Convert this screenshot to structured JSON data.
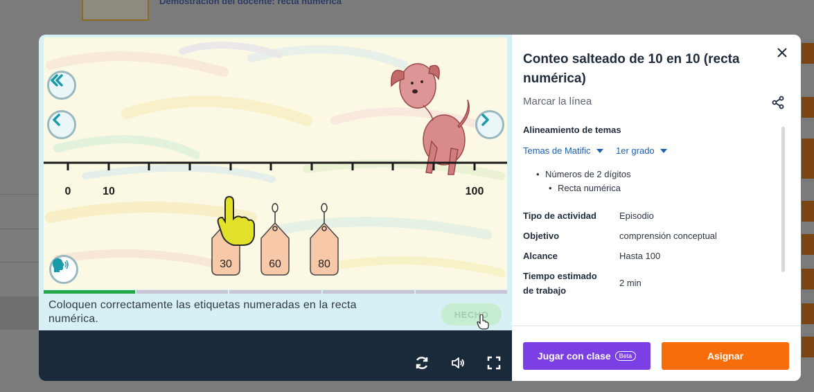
{
  "background": {
    "link_text": "Demostración del docente: recta numérica"
  },
  "game": {
    "number_labels": [
      "0",
      "10",
      "100"
    ],
    "tags": [
      "30",
      "60",
      "80"
    ],
    "instruction": "Coloquen correctamente las etiquetas numeradas en la recta numérica.",
    "done_label": "HECHO",
    "icons": {
      "rewind": "double-chevron-left-icon",
      "back": "chevron-left-icon",
      "next": "chevron-right-icon",
      "audio": "speaker-head-icon",
      "restart": "refresh-icon",
      "volume": "volume-icon",
      "fullscreen": "fullscreen-icon"
    }
  },
  "panel": {
    "title": "Conteo salteado de 10 en 10 (recta numérica)",
    "subtitle": "Marcar la línea",
    "alignment_heading": "Alineamiento de temas",
    "topic_dropdown": "Temas de Matific",
    "grade_dropdown": "1er grado",
    "topic": "Números de 2 dígitos",
    "subtopic": "Recta numérica",
    "details": [
      {
        "key": "Tipo de actividad",
        "value": "Episodio"
      },
      {
        "key": "Objetivo",
        "value": "comprensión conceptual"
      },
      {
        "key": "Alcance",
        "value": "Hasta 100"
      },
      {
        "key": "Tiempo estimado de trabajo",
        "value": "2 min"
      }
    ],
    "play_button": "Jugar con clase",
    "beta_badge": "Beta",
    "assign_button": "Asignar"
  },
  "colors": {
    "accent_purple": "#7b3fe4",
    "accent_orange": "#f76d0b",
    "link_blue": "#1d5fb0",
    "progress_green": "#24a64a"
  }
}
